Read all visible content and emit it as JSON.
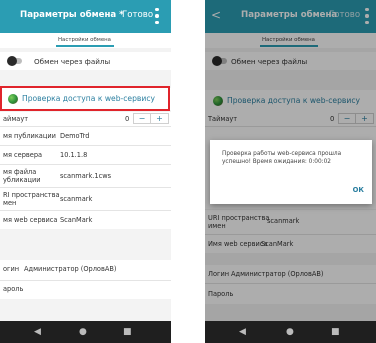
{
  "left": {
    "title": "Параметры обмена *",
    "done": "Готово",
    "tab": "Настройки обмена",
    "exchange_via_files": "Обмен через файлы",
    "check_access": "Проверка доступа к web-сервису",
    "timeout_label": "аймаут",
    "timeout_value": "0",
    "pub_name_label": "мя публикации",
    "pub_name_value": "DemoTrd",
    "server_label": "мя сервера",
    "server_value": "10.1.1.8",
    "file_label_1": "мя файла",
    "file_label_2": "убликации",
    "file_value": "scanmark.1cws",
    "uri_label_1": "RI пространства",
    "uri_label_2": "мен",
    "uri_value": "scanmark",
    "ws_label": "мя web сервиса",
    "ws_value": "ScanMark",
    "login_label": "огин",
    "login_value": "Администратор (ОрловАВ)",
    "password_label": "ароль"
  },
  "right": {
    "title": "Параметры обмена",
    "done": "Готово",
    "tab": "Настройки обмена",
    "exchange_via_files": "Обмен через файлы",
    "check_access": "Проверка доступа к web-сервису",
    "timeout_label": "Таймаут",
    "timeout_value": "0",
    "dialog_message": "Проверка работы web-сервиса прошла успешно! Время ожидания: 0:00:02",
    "dialog_ok": "ОК",
    "uri_label_1": "URI пространства",
    "uri_label_2": "имен",
    "uri_value": "scanmark",
    "ws_label": "Имя web сервиса",
    "ws_value": "ScanMark",
    "login_label": "Логин",
    "login_value": "Администратор (ОрловАВ)",
    "password_label": "Пароль"
  },
  "stepper": {
    "minus": "−",
    "plus": "+"
  },
  "nav": {
    "back": "◀",
    "home": "●",
    "recents": "■"
  },
  "header_back": "<",
  "icons": [
    "back-arrow-icon",
    "overflow-menu-icon",
    "globe-icon",
    "toggle-switch",
    "nav-back-icon",
    "nav-home-icon",
    "nav-recents-icon"
  ],
  "colors": {
    "accent": "#2b9db3",
    "highlight": "#e0242b",
    "link": "#2b7fa0",
    "navbar": "#1f1f1f"
  }
}
